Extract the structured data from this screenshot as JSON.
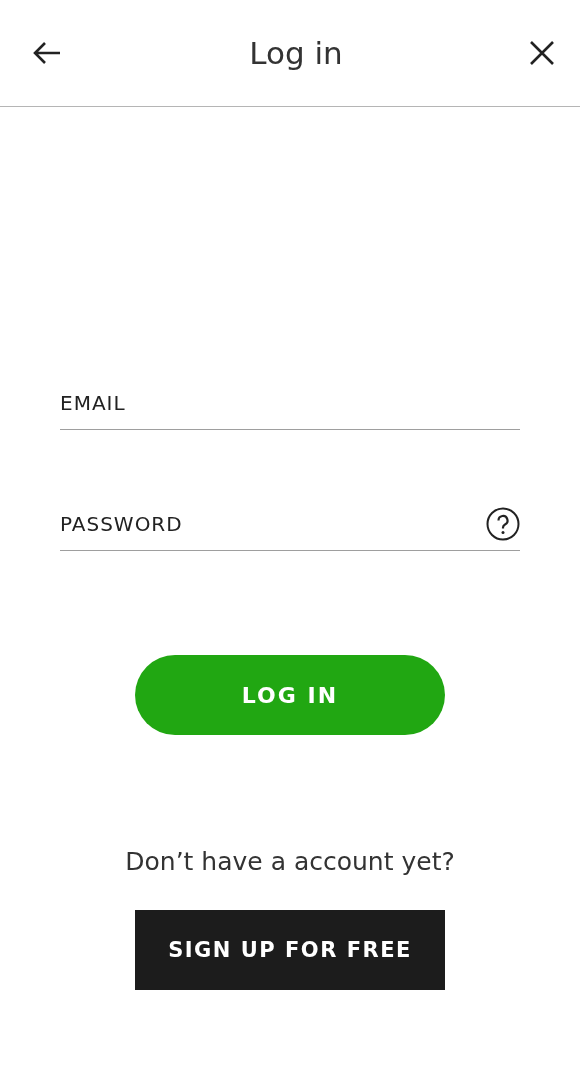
{
  "header": {
    "title": "Log in"
  },
  "fields": [
    {
      "placeholder": "EMAIL",
      "help": false
    },
    {
      "placeholder": "PASSWORD",
      "help": true
    }
  ],
  "login_button": "LOG IN",
  "signup_prompt": "Don’t have a account yet?",
  "signup_button": "SIGN UP FOR FREE"
}
